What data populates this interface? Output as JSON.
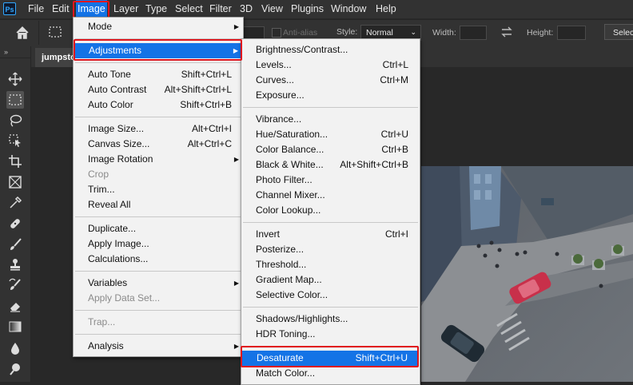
{
  "app": {
    "logo_text": "Ps"
  },
  "menubar": [
    "File",
    "Edit",
    "Image",
    "Layer",
    "Type",
    "Select",
    "Filter",
    "3D",
    "View",
    "Plugins",
    "Window",
    "Help"
  ],
  "options_bar": {
    "anti_alias": "Anti-alias",
    "style_label": "Style:",
    "style_value": "Normal",
    "width_label": "Width:",
    "height_label": "Height:",
    "select_button": "Select"
  },
  "document": {
    "tab_title": "jumpsto"
  },
  "image_menu": {
    "groups": [
      [
        {
          "label": "Mode",
          "arrow": true
        }
      ],
      [
        {
          "label": "Adjustments",
          "arrow": true,
          "selected": true
        }
      ],
      [
        {
          "label": "Auto Tone",
          "shortcut": "Shift+Ctrl+L"
        },
        {
          "label": "Auto Contrast",
          "shortcut": "Alt+Shift+Ctrl+L"
        },
        {
          "label": "Auto Color",
          "shortcut": "Shift+Ctrl+B"
        }
      ],
      [
        {
          "label": "Image Size...",
          "shortcut": "Alt+Ctrl+I"
        },
        {
          "label": "Canvas Size...",
          "shortcut": "Alt+Ctrl+C"
        },
        {
          "label": "Image Rotation",
          "arrow": true
        },
        {
          "label": "Crop",
          "disabled": true
        },
        {
          "label": "Trim..."
        },
        {
          "label": "Reveal All"
        }
      ],
      [
        {
          "label": "Duplicate..."
        },
        {
          "label": "Apply Image..."
        },
        {
          "label": "Calculations..."
        }
      ],
      [
        {
          "label": "Variables",
          "arrow": true
        },
        {
          "label": "Apply Data Set...",
          "disabled": true
        }
      ],
      [
        {
          "label": "Trap...",
          "disabled": true
        }
      ],
      [
        {
          "label": "Analysis",
          "arrow": true
        }
      ]
    ]
  },
  "adjustments_menu": {
    "groups": [
      [
        {
          "label": "Brightness/Contrast..."
        },
        {
          "label": "Levels...",
          "shortcut": "Ctrl+L"
        },
        {
          "label": "Curves...",
          "shortcut": "Ctrl+M"
        },
        {
          "label": "Exposure..."
        }
      ],
      [
        {
          "label": "Vibrance..."
        },
        {
          "label": "Hue/Saturation...",
          "shortcut": "Ctrl+U"
        },
        {
          "label": "Color Balance...",
          "shortcut": "Ctrl+B"
        },
        {
          "label": "Black & White...",
          "shortcut": "Alt+Shift+Ctrl+B"
        },
        {
          "label": "Photo Filter..."
        },
        {
          "label": "Channel Mixer..."
        },
        {
          "label": "Color Lookup..."
        }
      ],
      [
        {
          "label": "Invert",
          "shortcut": "Ctrl+I"
        },
        {
          "label": "Posterize..."
        },
        {
          "label": "Threshold..."
        },
        {
          "label": "Gradient Map..."
        },
        {
          "label": "Selective Color..."
        }
      ],
      [
        {
          "label": "Shadows/Highlights..."
        },
        {
          "label": "HDR Toning..."
        }
      ],
      [
        {
          "label": "Desaturate",
          "shortcut": "Shift+Ctrl+U",
          "selected": true
        },
        {
          "label": "Match Color..."
        }
      ]
    ]
  },
  "colors": {
    "accent": "#1473e6",
    "highlight": "#e0161d"
  }
}
